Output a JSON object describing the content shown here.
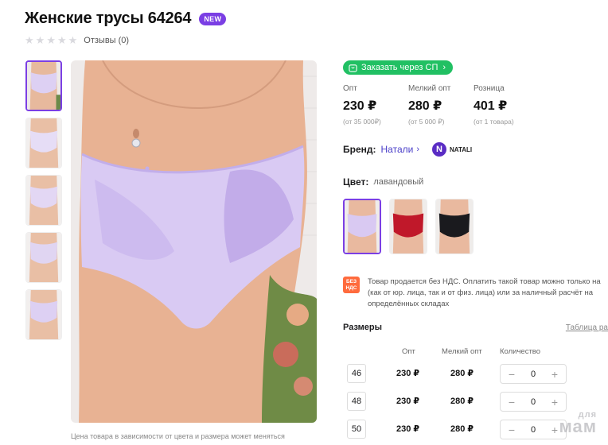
{
  "product": {
    "title": "Женские трусы 64264",
    "badge": "NEW",
    "reviews_label": "Отзывы (0)",
    "rating_stars": 0,
    "caption": "Цена товара в зависимости от цвета и размера может меняться"
  },
  "sp_button": {
    "label": "Заказать через СП",
    "color": "#21c063"
  },
  "prices": [
    {
      "label": "Опт",
      "value": "230 ₽",
      "note": "(от 35 000₽)"
    },
    {
      "label": "Мелкий опт",
      "value": "280 ₽",
      "note": "(от 5 000 ₽)"
    },
    {
      "label": "Розница",
      "value": "401 ₽",
      "note": "(от 1 товара)"
    }
  ],
  "brand": {
    "label": "Бренд:",
    "name": "Натали",
    "logo_letter": "N",
    "logo_text": "NATALI"
  },
  "color": {
    "label": "Цвет:",
    "value": "лавандовый"
  },
  "swatches": [
    {
      "name": "лавандовый",
      "hex": "#d9c9f2",
      "selected": true
    },
    {
      "name": "красный",
      "hex": "#c0182a",
      "selected": false
    },
    {
      "name": "черный",
      "hex": "#1a1a1e",
      "selected": false
    }
  ],
  "nds": {
    "icon_text": "БЕЗ НДС",
    "lines": [
      "Товар продается без НДС. Оплатить такой товар можно только на",
      "(как от юр. лица, так и от физ. лица) или за наличный расчёт на",
      "определённых складах"
    ]
  },
  "sizes": {
    "title": "Размеры",
    "table_link": "Таблица ра",
    "headers": {
      "opt": "Опт",
      "small_opt": "Мелкий опт",
      "qty": "Количество"
    },
    "rows": [
      {
        "size": "46",
        "opt": "230 ₽",
        "small_opt": "280 ₽",
        "qty": "0"
      },
      {
        "size": "48",
        "opt": "230 ₽",
        "small_opt": "280 ₽",
        "qty": "0"
      },
      {
        "size": "50",
        "opt": "230 ₽",
        "small_opt": "280 ₽",
        "qty": "0"
      }
    ]
  },
  "watermark": {
    "line1": "для",
    "line2": "мам"
  },
  "colors": {
    "accent": "#7b3fe4",
    "link": "#4a3fc9",
    "nds": "#ff6b3d"
  }
}
